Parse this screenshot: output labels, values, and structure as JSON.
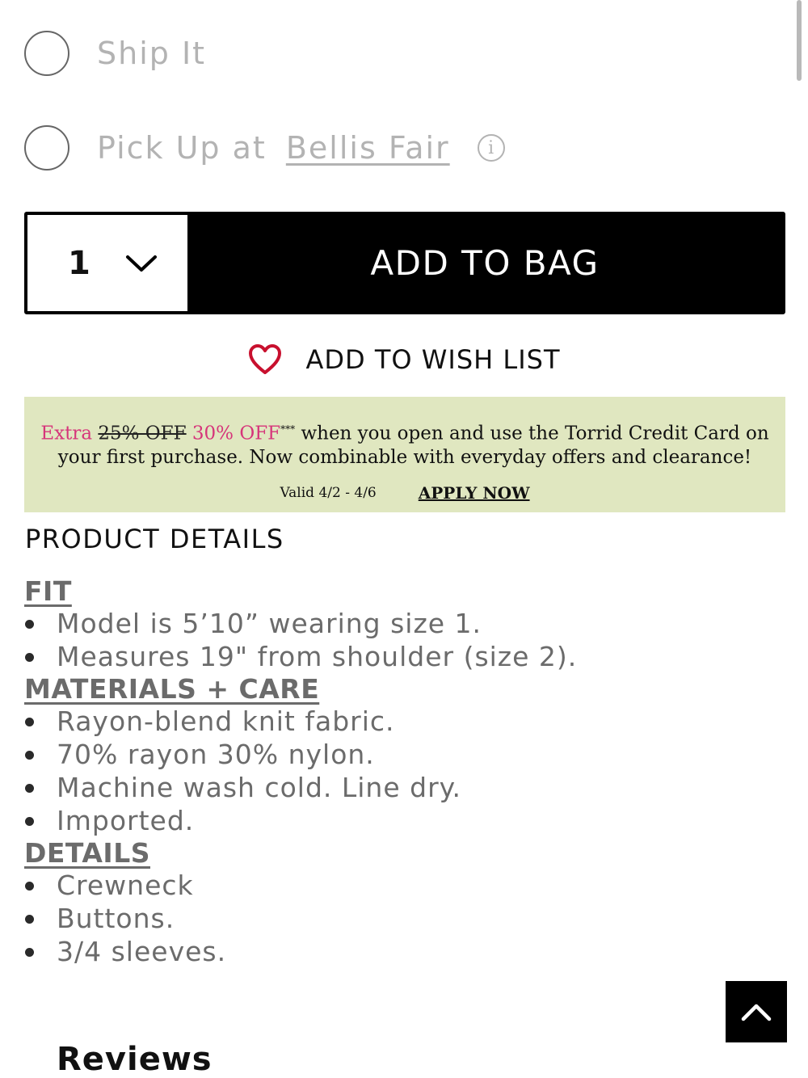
{
  "delivery": {
    "ship_it": "Ship It",
    "pick_up_prefix": "Pick Up at",
    "store_name": "Bellis Fair",
    "info_glyph": "i"
  },
  "cart": {
    "quantity": "1",
    "add_to_bag": "ADD TO BAG"
  },
  "wishlist": {
    "label": "ADD TO WISH LIST",
    "heart_color": "#c8102e"
  },
  "promo": {
    "extra": "Extra",
    "old_offer": "25% OFF",
    "new_offer": "30% OFF",
    "asterisks": "***",
    "text_line1_rest": "when you open and use the Torrid Credit Card on",
    "text_line2": "your first purchase. Now combinable with everyday offers and clearance!",
    "valid": "Valid 4/2 - 4/6",
    "apply_now": "APPLY NOW",
    "background": "#e0e7c0",
    "accent": "#d6357a"
  },
  "product_details": {
    "heading": "PRODUCT DETAILS",
    "fit": {
      "title": "FIT",
      "items": [
        "Model is 5’10” wearing size 1.",
        "Measures 19\" from shoulder (size 2)."
      ]
    },
    "materials": {
      "title": "MATERIALS + CARE",
      "items": [
        "Rayon-blend knit fabric.",
        "70% rayon 30% nylon.",
        "Machine wash cold. Line dry.",
        "Imported."
      ]
    },
    "details": {
      "title": "DETAILS",
      "items": [
        "Crewneck",
        "Buttons.",
        "3/4 sleeves."
      ]
    }
  },
  "reviews": {
    "heading": "Reviews"
  },
  "icons": {
    "chevron": "chevron-down-icon",
    "heart": "heart-icon",
    "info": "info-icon",
    "scroll_top": "chevron-up-icon"
  }
}
